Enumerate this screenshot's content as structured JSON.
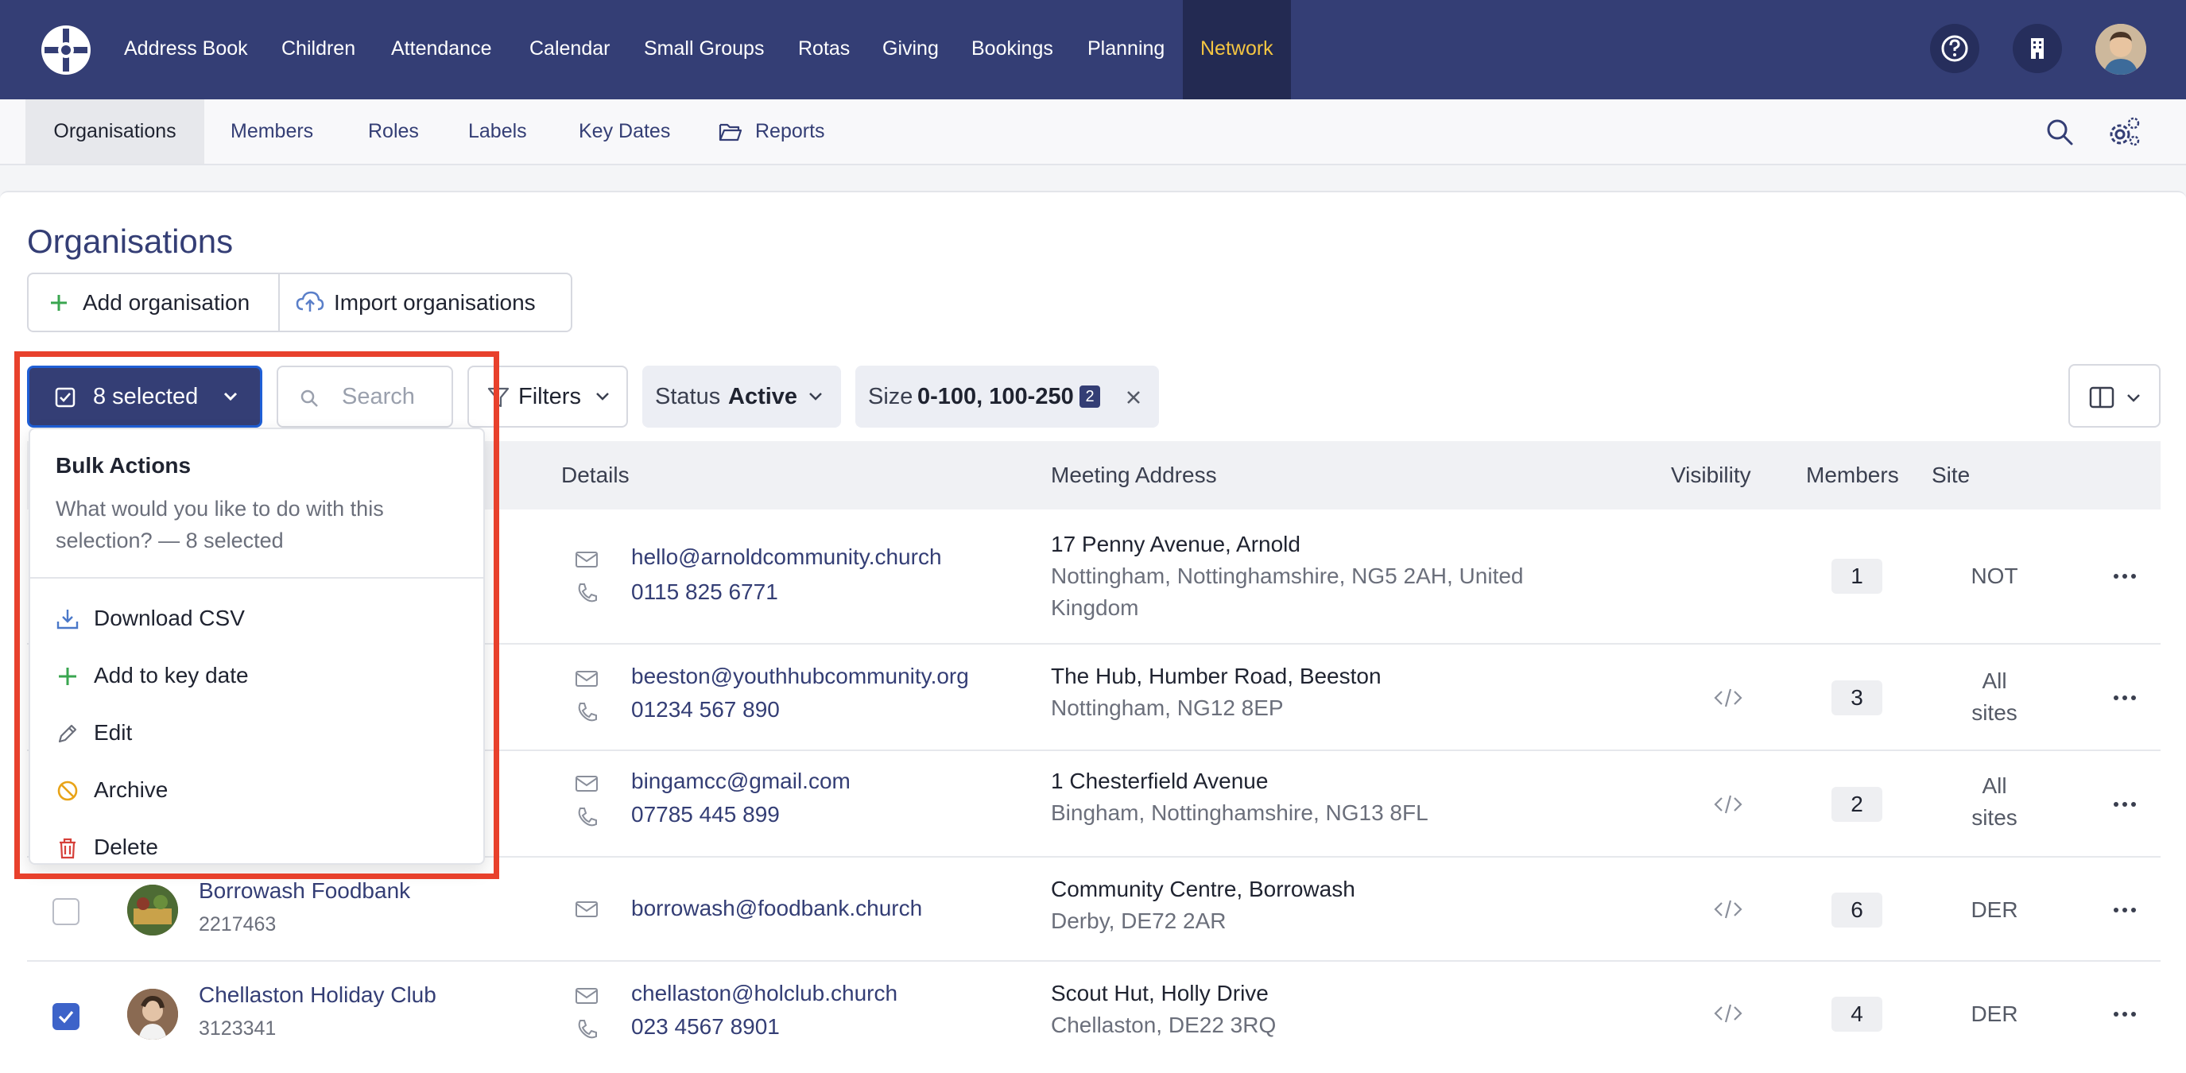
{
  "topnav": {
    "items": [
      "Address Book",
      "Children",
      "Attendance",
      "Calendar",
      "Small Groups",
      "Rotas",
      "Giving",
      "Bookings",
      "Planning",
      "Network"
    ],
    "active": "Network",
    "help_icon": "question-circle-icon",
    "building_icon": "building-icon"
  },
  "subnav": {
    "items": [
      "Organisations",
      "Members",
      "Roles",
      "Labels",
      "Key Dates",
      "Reports"
    ],
    "active": "Organisations"
  },
  "page": {
    "title": "Organisations",
    "add_label": "Add organisation",
    "import_label": "Import organisations"
  },
  "toolbar": {
    "selected_label": "8 selected",
    "search_placeholder": "Search",
    "filters_label": "Filters",
    "status_key": "Status",
    "status_value": "Active",
    "size_key": "Size",
    "size_value": "0-100, 100-250",
    "size_count": "2"
  },
  "table": {
    "columns": [
      "Details",
      "Meeting Address",
      "Visibility",
      "Members",
      "Site"
    ],
    "rows": [
      {
        "name": "",
        "id": "",
        "email": "hello@arnoldcommunity.church",
        "phone": "0115 825 6771",
        "addr1": "17 Penny Avenue, Arnold",
        "addr2": "Nottingham, Nottinghamshire, NG5 2AH, United",
        "addr3": "Kingdom",
        "members": "1",
        "site": "NOT",
        "checked": false
      },
      {
        "name": "",
        "id": "",
        "email": "beeston@youthhubcommunity.org",
        "phone": "01234 567 890",
        "addr1": "The Hub, Humber Road, Beeston",
        "addr2": "Nottingham, NG12 8EP",
        "addr3": "",
        "members": "3",
        "site1": "All",
        "site2": "sites",
        "checked": false
      },
      {
        "name": "",
        "id": "",
        "email": "bingamcc@gmail.com",
        "phone": "07785 445 899",
        "addr1": "1 Chesterfield Avenue",
        "addr2": "Bingham, Nottinghamshire, NG13 8FL",
        "addr3": "",
        "members": "2",
        "site1": "All",
        "site2": "sites",
        "checked": false
      },
      {
        "name": "Borrowash Foodbank",
        "id": "2217463",
        "email": "borrowash@foodbank.church",
        "phone": "",
        "addr1": "Community Centre, Borrowash",
        "addr2": "Derby, DE72 2AR",
        "addr3": "",
        "members": "6",
        "site": "DER",
        "checked": false
      },
      {
        "name": "Chellaston Holiday Club",
        "id": "3123341",
        "email": "chellaston@holclub.church",
        "phone": "023 4567 8901",
        "addr1": "Scout Hut, Holly Drive",
        "addr2": "Chellaston, DE22 3RQ",
        "addr3": "",
        "members": "4",
        "site": "DER",
        "checked": true
      }
    ]
  },
  "bulk": {
    "title": "Bulk Actions",
    "description": "What would you like to do with this selection? — 8 selected",
    "actions": [
      "Download CSV",
      "Add to key date",
      "Edit",
      "Archive",
      "Delete"
    ]
  },
  "colors": {
    "nav_bg": "#343e75",
    "nav_active": "#f4c542",
    "highlight": "#e8412c",
    "link": "#343e75"
  }
}
